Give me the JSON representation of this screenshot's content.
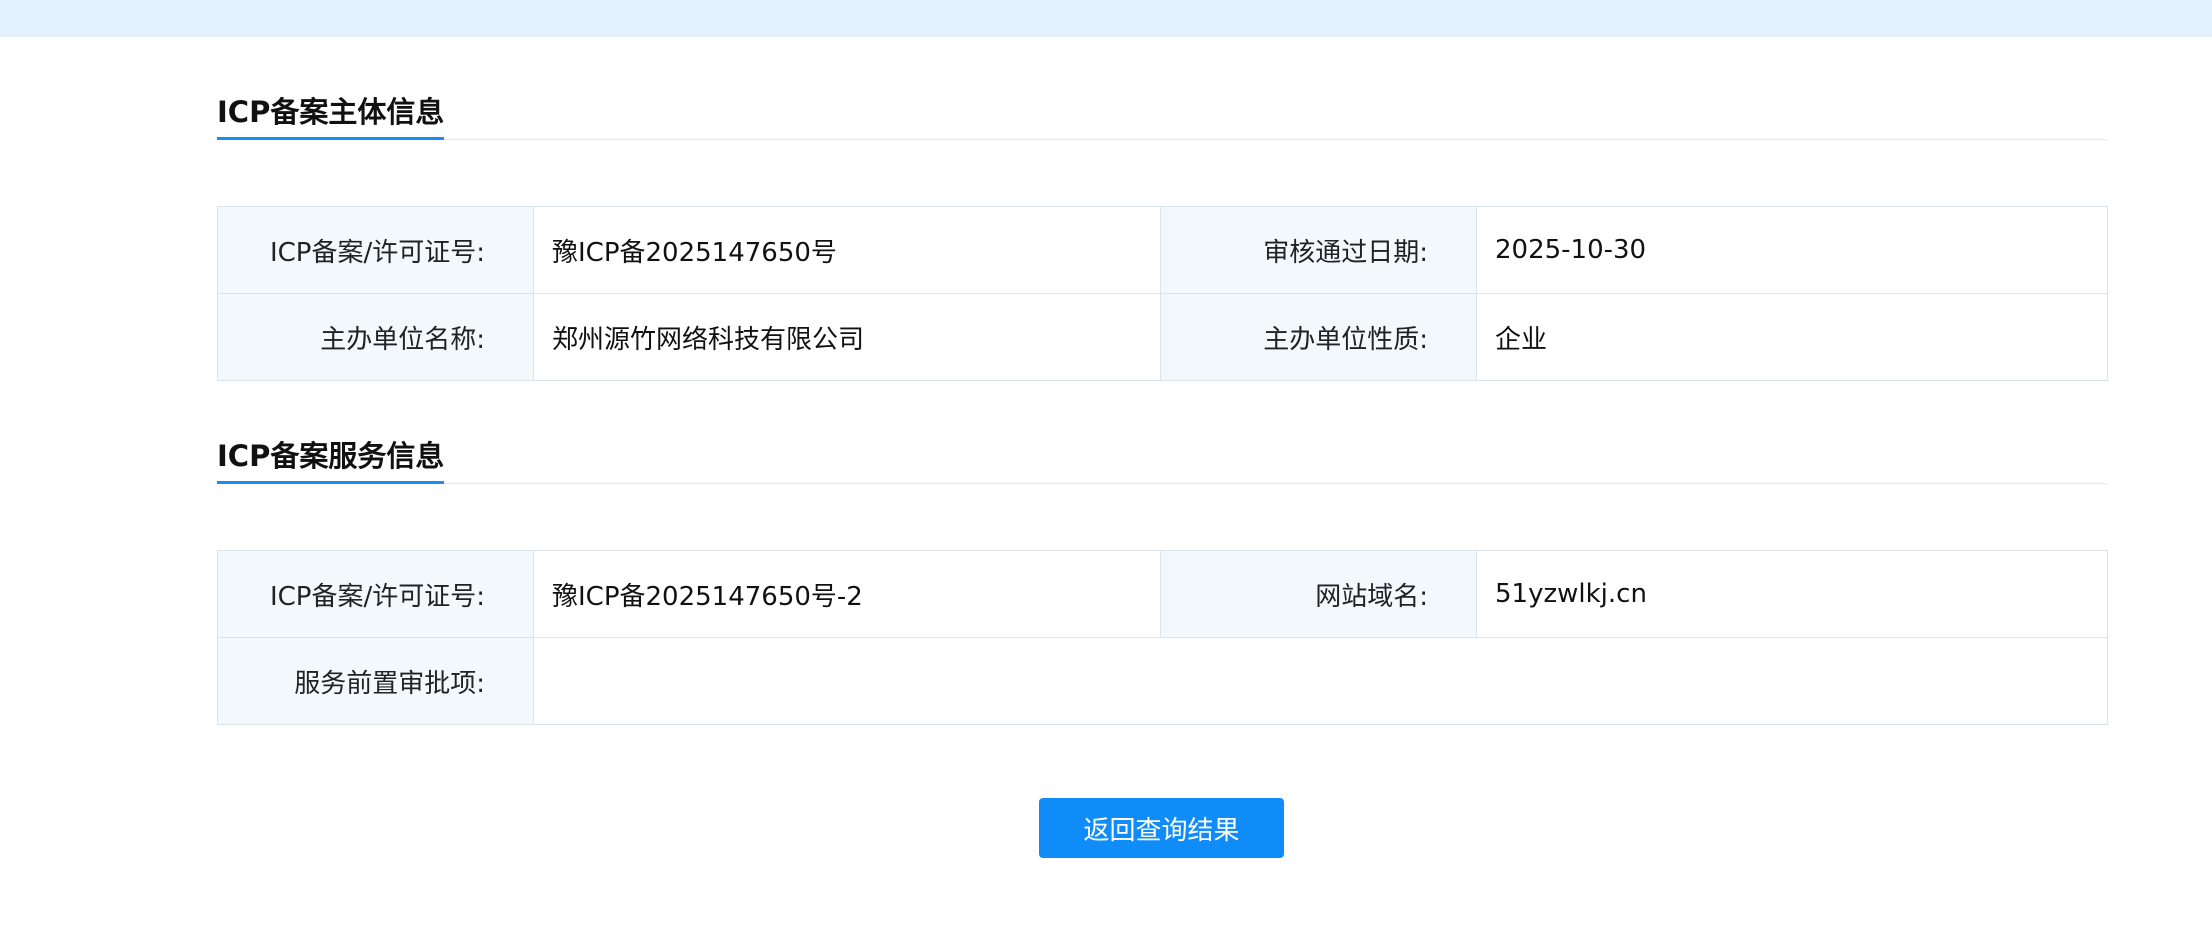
{
  "sections": [
    {
      "title": "ICP备案主体信息",
      "rows": [
        [
          {
            "label": "ICP备案/许可证号:",
            "value": "豫ICP备2025147650号"
          },
          {
            "label": "审核通过日期:",
            "value": "2025-10-30"
          }
        ],
        [
          {
            "label": "主办单位名称:",
            "value": "郑州源竹网络科技有限公司"
          },
          {
            "label": "主办单位性质:",
            "value": "企业"
          }
        ]
      ]
    },
    {
      "title": "ICP备案服务信息",
      "rows": [
        [
          {
            "label": "ICP备案/许可证号:",
            "value": "豫ICP备2025147650号-2"
          },
          {
            "label": "网站域名:",
            "value": "51yzwlkj.cn"
          }
        ],
        [
          {
            "label": "服务前置审批项:",
            "value": ""
          }
        ]
      ]
    }
  ],
  "back_button": {
    "label": "返回查询结果"
  },
  "colors": {
    "accent": "#1a8cf5",
    "button": "#0f8cf7",
    "top_bar": "#e3f1fd",
    "label_bg": "#f3f8fd",
    "border": "#dbe3ec"
  }
}
